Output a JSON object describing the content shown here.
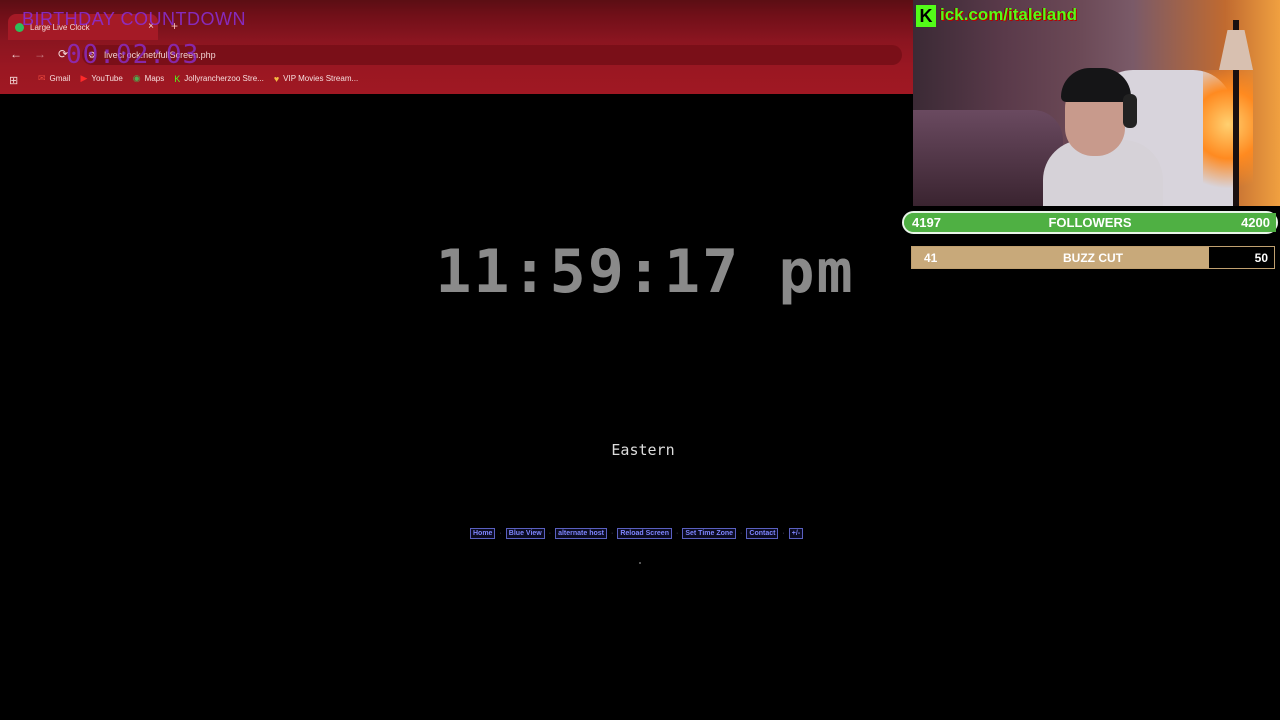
{
  "browser": {
    "tab_title": "Large Live Clock",
    "tab_close": "×",
    "new_tab": "+",
    "nav": {
      "back": "←",
      "forward": "→",
      "reload": "⟳"
    },
    "url": "livecl ock.net/fullScreen.php",
    "site_info_icon": "⚙",
    "apps_icon": "⊞",
    "bookmarks": [
      {
        "label": "Gmail",
        "icon": "✉",
        "color": "#e8453c"
      },
      {
        "label": "YouTube",
        "icon": "▶",
        "color": "#ff2a2a"
      },
      {
        "label": "Maps",
        "icon": "◉",
        "color": "#4caf50"
      },
      {
        "label": "Jollyrancherzoo Stre...",
        "icon": "K",
        "color": "#53fc18"
      },
      {
        "label": "VIP Movies Stream...",
        "icon": "♥",
        "color": "#f5b942"
      }
    ]
  },
  "overlay": {
    "countdown_title": "BIRTHDAY COUNTDOWN",
    "countdown_value": "00:02:03",
    "kick_logo": "K",
    "kick_url": "ick.com/italeland",
    "followers": {
      "current": "4197",
      "label": "FOLLOWERS",
      "goal": "4200",
      "progress": 0.9993
    },
    "buzzcut": {
      "current": "41",
      "label": "BUZZ CUT",
      "goal": "50",
      "progress": 0.82
    }
  },
  "clock_page": {
    "time": "11:59:17 pm",
    "timezone": "Eastern",
    "links": [
      "Home",
      "Blue View",
      "alternate host",
      "Reload Screen",
      "Set Time Zone",
      "Contact",
      "+/-"
    ],
    "link_separator": "·"
  }
}
